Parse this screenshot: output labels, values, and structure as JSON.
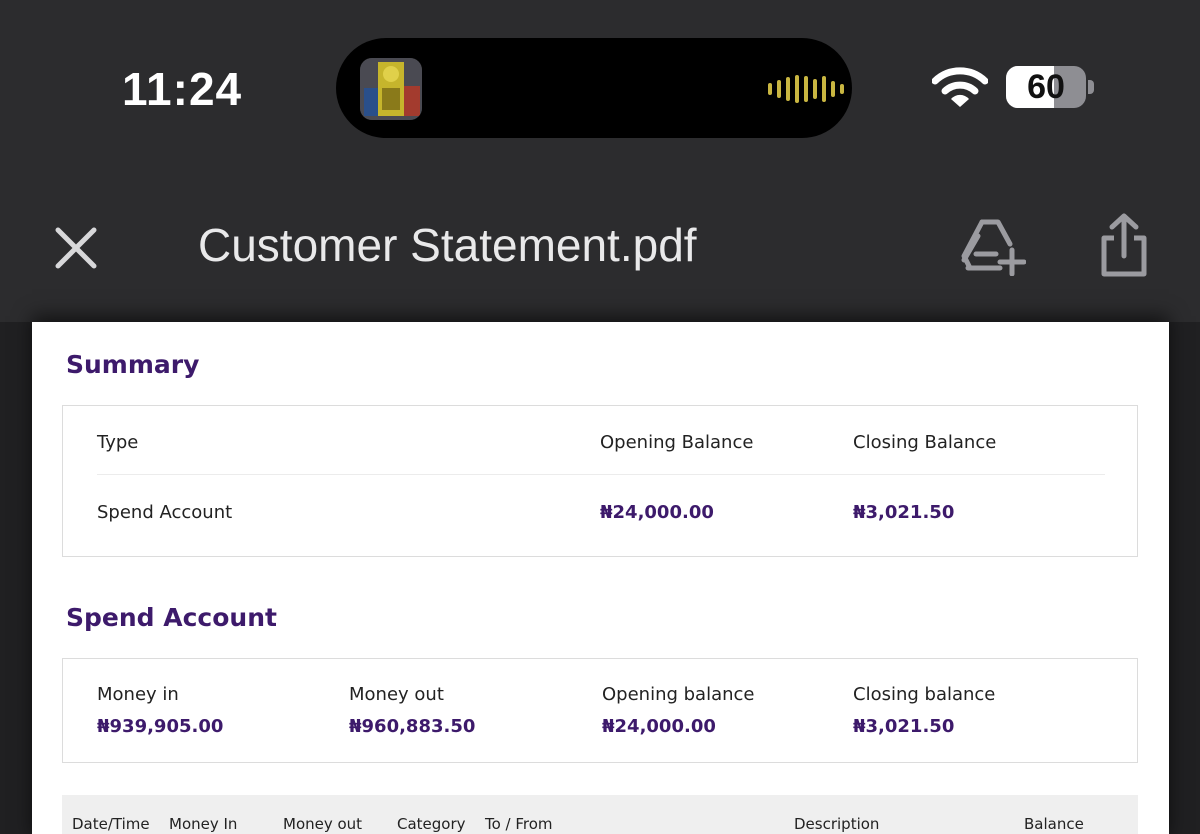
{
  "status_bar": {
    "time": "11:24",
    "battery_percent": "60",
    "battery_level": 0.6,
    "icons": [
      "app-thumbnail-icon",
      "audio-wave-icon",
      "wifi-icon",
      "battery-icon"
    ]
  },
  "toolbar": {
    "title": "Customer Statement.pdf",
    "icons": [
      "close-icon",
      "add-to-drive-icon",
      "share-icon"
    ]
  },
  "colors": {
    "chrome_bg": "#2c2c2e",
    "accent_purple": "#3d1a6b",
    "wave_gold": "#c9b641"
  },
  "summary": {
    "heading": "Summary",
    "columns": [
      "Type",
      "Opening Balance",
      "Closing Balance"
    ],
    "row": {
      "type": "Spend Account",
      "opening": "₦24,000.00",
      "closing": "₦3,021.50"
    }
  },
  "spend_account": {
    "heading": "Spend Account",
    "stats": [
      {
        "label": "Money in",
        "value": "₦939,905.00"
      },
      {
        "label": "Money out",
        "value": "₦960,883.50"
      },
      {
        "label": "Opening balance",
        "value": "₦24,000.00"
      },
      {
        "label": "Closing balance",
        "value": "₦3,021.50"
      }
    ]
  },
  "transactions_table": {
    "headers": [
      "Date/Time",
      "Money In",
      "Money out",
      "Category",
      "To / From",
      "Description",
      "Balance"
    ]
  }
}
